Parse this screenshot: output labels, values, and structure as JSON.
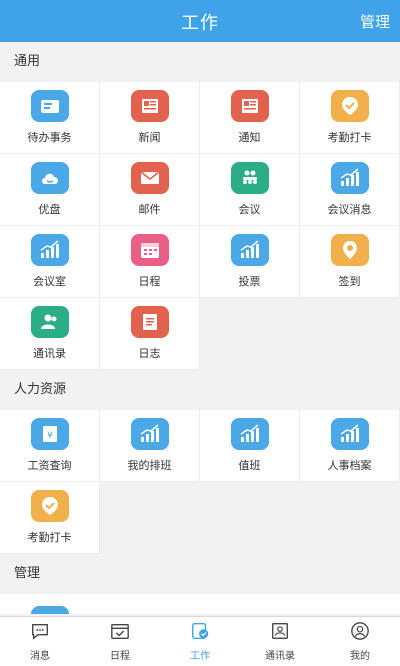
{
  "header": {
    "title": "工作",
    "manage": "管理"
  },
  "sections": [
    {
      "title": "通用",
      "items": [
        {
          "label": "待办事务",
          "icon": "todo-icon",
          "color": "#4aa8e6"
        },
        {
          "label": "新闻",
          "icon": "news-icon",
          "color": "#e2624f"
        },
        {
          "label": "通知",
          "icon": "notice-icon",
          "color": "#e2624f"
        },
        {
          "label": "考勤打卡",
          "icon": "attendance-icon",
          "color": "#f2b04c"
        },
        {
          "label": "优盘",
          "icon": "cloud-icon",
          "color": "#4aa8e6"
        },
        {
          "label": "邮件",
          "icon": "mail-icon",
          "color": "#e2624f"
        },
        {
          "label": "会议",
          "icon": "meeting-icon",
          "color": "#2bae88"
        },
        {
          "label": "会议消息",
          "icon": "chart-icon",
          "color": "#4aa8e6"
        },
        {
          "label": "会议室",
          "icon": "chart-icon",
          "color": "#4aa8e6"
        },
        {
          "label": "日程",
          "icon": "calendar-icon",
          "color": "#ea5f86"
        },
        {
          "label": "投票",
          "icon": "chart-icon",
          "color": "#4aa8e6"
        },
        {
          "label": "签到",
          "icon": "location-icon",
          "color": "#f2b04c"
        },
        {
          "label": "通讯录",
          "icon": "contacts-icon",
          "color": "#2bae88"
        },
        {
          "label": "日志",
          "icon": "log-icon",
          "color": "#e2624f"
        }
      ]
    },
    {
      "title": "人力资源",
      "items": [
        {
          "label": "工资查询",
          "icon": "salary-icon",
          "color": "#4aa8e6"
        },
        {
          "label": "我的排班",
          "icon": "chart-icon",
          "color": "#4aa8e6"
        },
        {
          "label": "值班",
          "icon": "chart-icon",
          "color": "#4aa8e6"
        },
        {
          "label": "人事档案",
          "icon": "chart-icon",
          "color": "#4aa8e6"
        },
        {
          "label": "考勤打卡",
          "icon": "attendance-icon",
          "color": "#f2b04c"
        }
      ]
    },
    {
      "title": "管理",
      "items": []
    }
  ],
  "nav": [
    {
      "label": "消息",
      "icon": "message-icon",
      "active": false
    },
    {
      "label": "日程",
      "icon": "calendar-icon",
      "active": false
    },
    {
      "label": "工作",
      "icon": "work-icon",
      "active": true
    },
    {
      "label": "通讯录",
      "icon": "contacts-icon",
      "active": false
    },
    {
      "label": "我的",
      "icon": "profile-icon",
      "active": false
    }
  ]
}
